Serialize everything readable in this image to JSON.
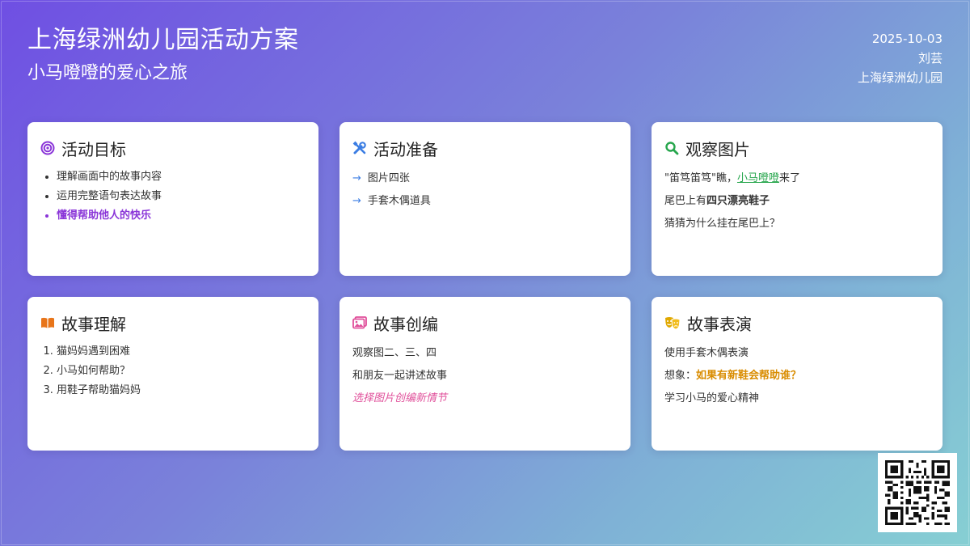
{
  "header": {
    "title": "上海绿洲幼儿园活动方案",
    "subtitle": "小马噔噔的爱心之旅",
    "date": "2025-10-03",
    "author": "刘芸",
    "school": "上海绿洲幼儿园"
  },
  "cards": {
    "goals": {
      "icon": "target-icon",
      "title": "活动目标",
      "items": [
        "理解画面中的故事内容",
        "运用完整语句表达故事"
      ],
      "highlight": "懂得帮助他人的快乐"
    },
    "prep": {
      "icon": "tools-icon",
      "title": "活动准备",
      "items": [
        "图片四张",
        "手套木偶道具"
      ]
    },
    "observe": {
      "icon": "search-icon",
      "title": "观察图片",
      "line1_pre": "\"笛笃笛笃\"瞧，",
      "line1_link": "小马噔噔",
      "line1_post": "来了",
      "line2_pre": "尾巴上有",
      "line2_bold": "四只漂亮鞋子",
      "line3": "猜猜为什么挂在尾巴上？"
    },
    "understand": {
      "icon": "book-icon",
      "title": "故事理解",
      "items": [
        "猫妈妈遇到困难",
        "小马如何帮助？",
        "用鞋子帮助猫妈妈"
      ]
    },
    "create": {
      "icon": "image-icon",
      "title": "故事创编",
      "line1": "观察图二、三、四",
      "line2": "和朋友一起讲述故事",
      "line3": "选择图片创编新情节"
    },
    "perform": {
      "icon": "theater-masks-icon",
      "title": "故事表演",
      "line1": "使用手套木偶表演",
      "line2_pre": "想象：",
      "line2_bold": "如果有新鞋会帮助谁？",
      "line3": "学习小马的爱心精神"
    }
  },
  "colors": {
    "purple": "#8a35d8",
    "blue": "#3b7de3",
    "green": "#27a64d",
    "orange": "#e8751a",
    "pink": "#e04f9a",
    "gold": "#d98c00"
  },
  "qr": {
    "icon": "qr-code-icon"
  }
}
